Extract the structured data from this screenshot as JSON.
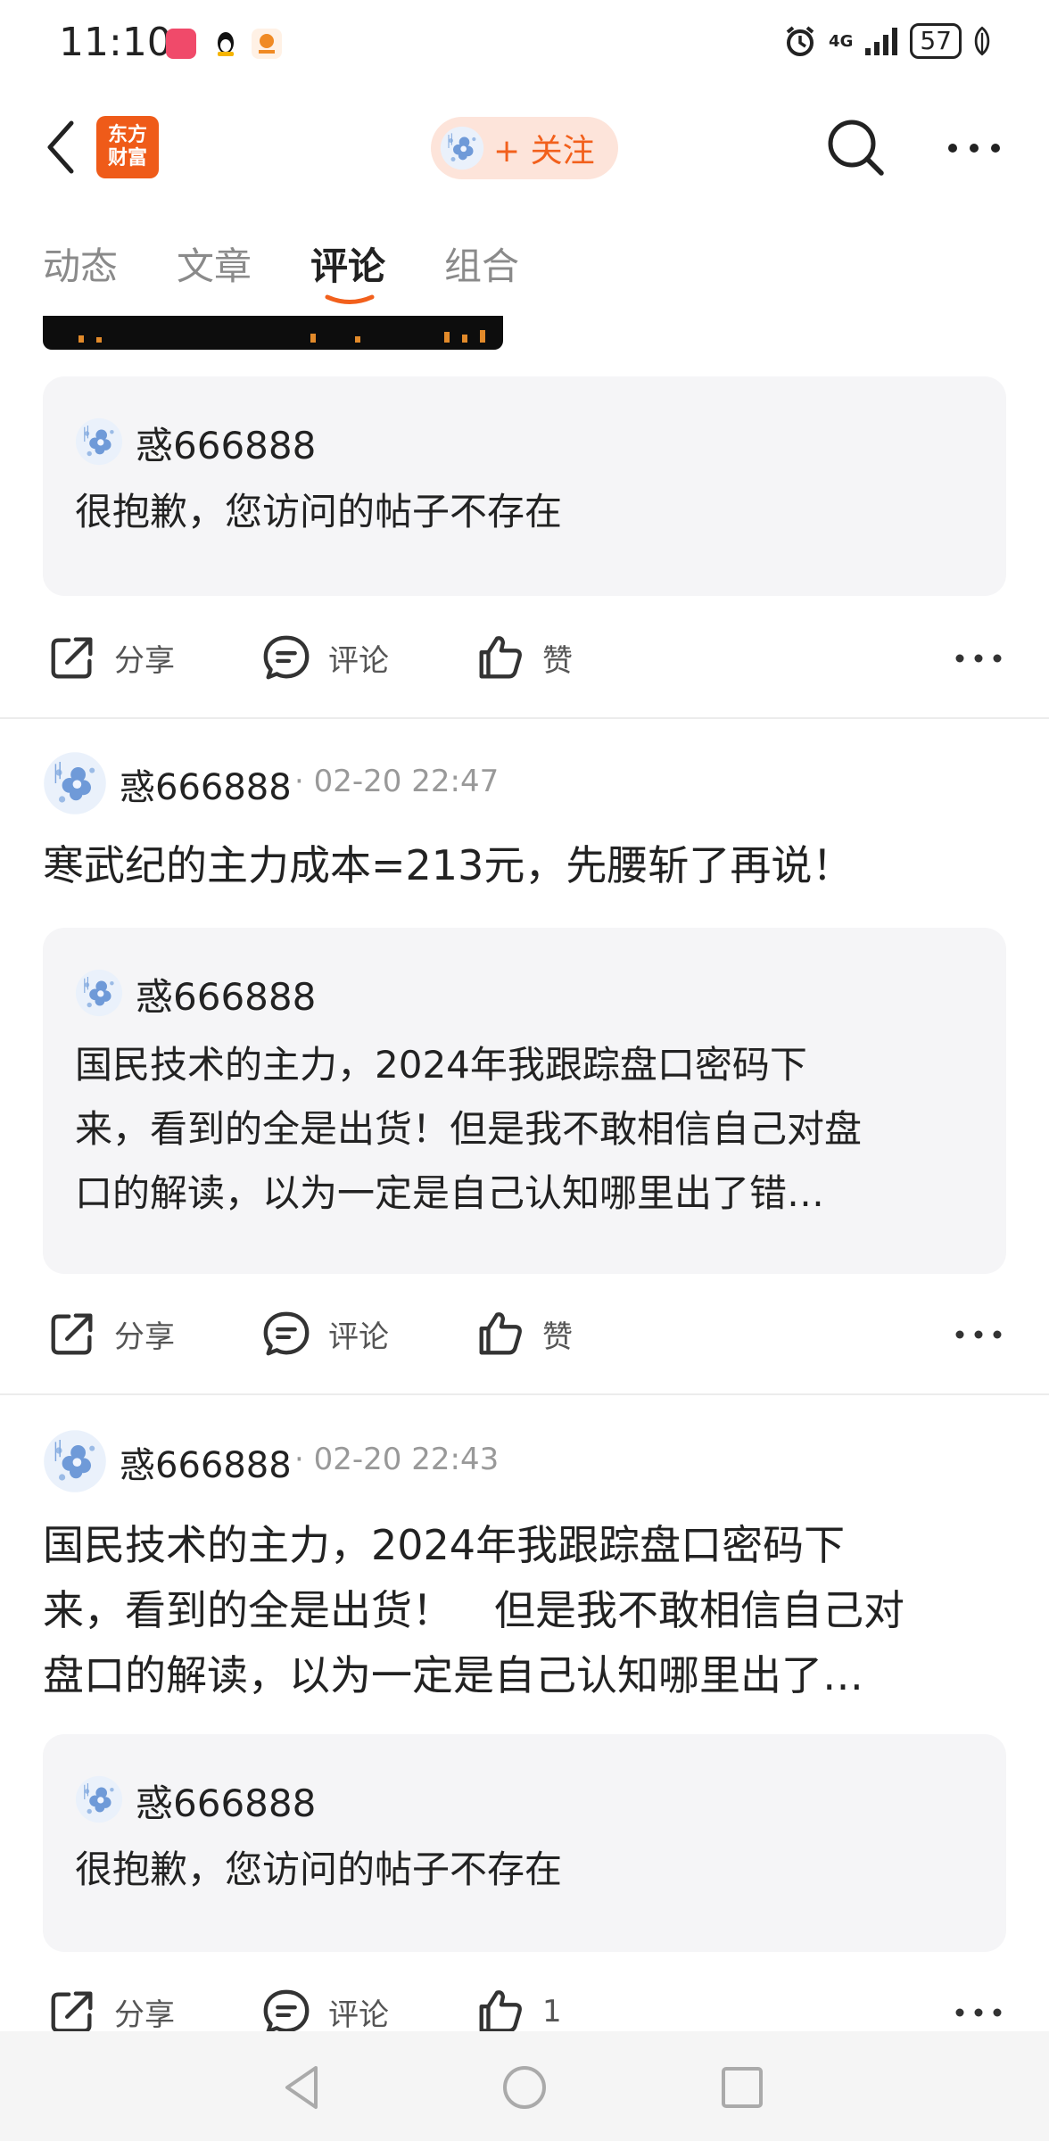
{
  "status_bar": {
    "time": "11:10",
    "network": "4G",
    "battery": "57",
    "icons": [
      "app-notification-icon",
      "qq-icon",
      "app-icon",
      "alarm-icon",
      "signal-icon",
      "battery-icon",
      "leaf-icon"
    ]
  },
  "header": {
    "logo_line1": "东方",
    "logo_line2": "财富",
    "follow_label": "+ 关注",
    "colors": {
      "brand": "#ef5b19",
      "follow_bg": "#fde4da",
      "follow_text": "#f2601c"
    }
  },
  "tabs": [
    {
      "label": "动态",
      "active": false
    },
    {
      "label": "文章",
      "active": false
    },
    {
      "label": "评论",
      "active": true
    },
    {
      "label": "组合",
      "active": false
    }
  ],
  "actions": {
    "share": "分享",
    "comment": "评论",
    "like": "赞"
  },
  "feed": [
    {
      "quote": {
        "username": "惑666888",
        "text": "很抱歉，您访问的帖子不存在"
      }
    },
    {
      "username": "惑666888",
      "dot": "·",
      "time": "02-20 22:47",
      "text": "寒武纪的主力成本=213元，先腰斩了再说！",
      "quote": {
        "username": "惑666888",
        "text_lines": [
          "国民技术的主力，2024年我跟踪盘口密码下",
          "来，看到的全是出货！但是我不敢相信自己对盘",
          "口的解读，以为一定是自己认知哪里出了错…"
        ]
      }
    },
    {
      "username": "惑666888",
      "dot": "·",
      "time": "02-20 22:43",
      "text_lines": [
        "国民技术的主力，2024年我跟踪盘口密码下",
        "来，看到的全是出货！　但是我不敢相信自己对",
        "盘口的解读，以为一定是自己认知哪里出了…"
      ],
      "quote": {
        "username": "惑666888",
        "text": "很抱歉，您访问的帖子不存在"
      },
      "like_count": "1"
    }
  ]
}
